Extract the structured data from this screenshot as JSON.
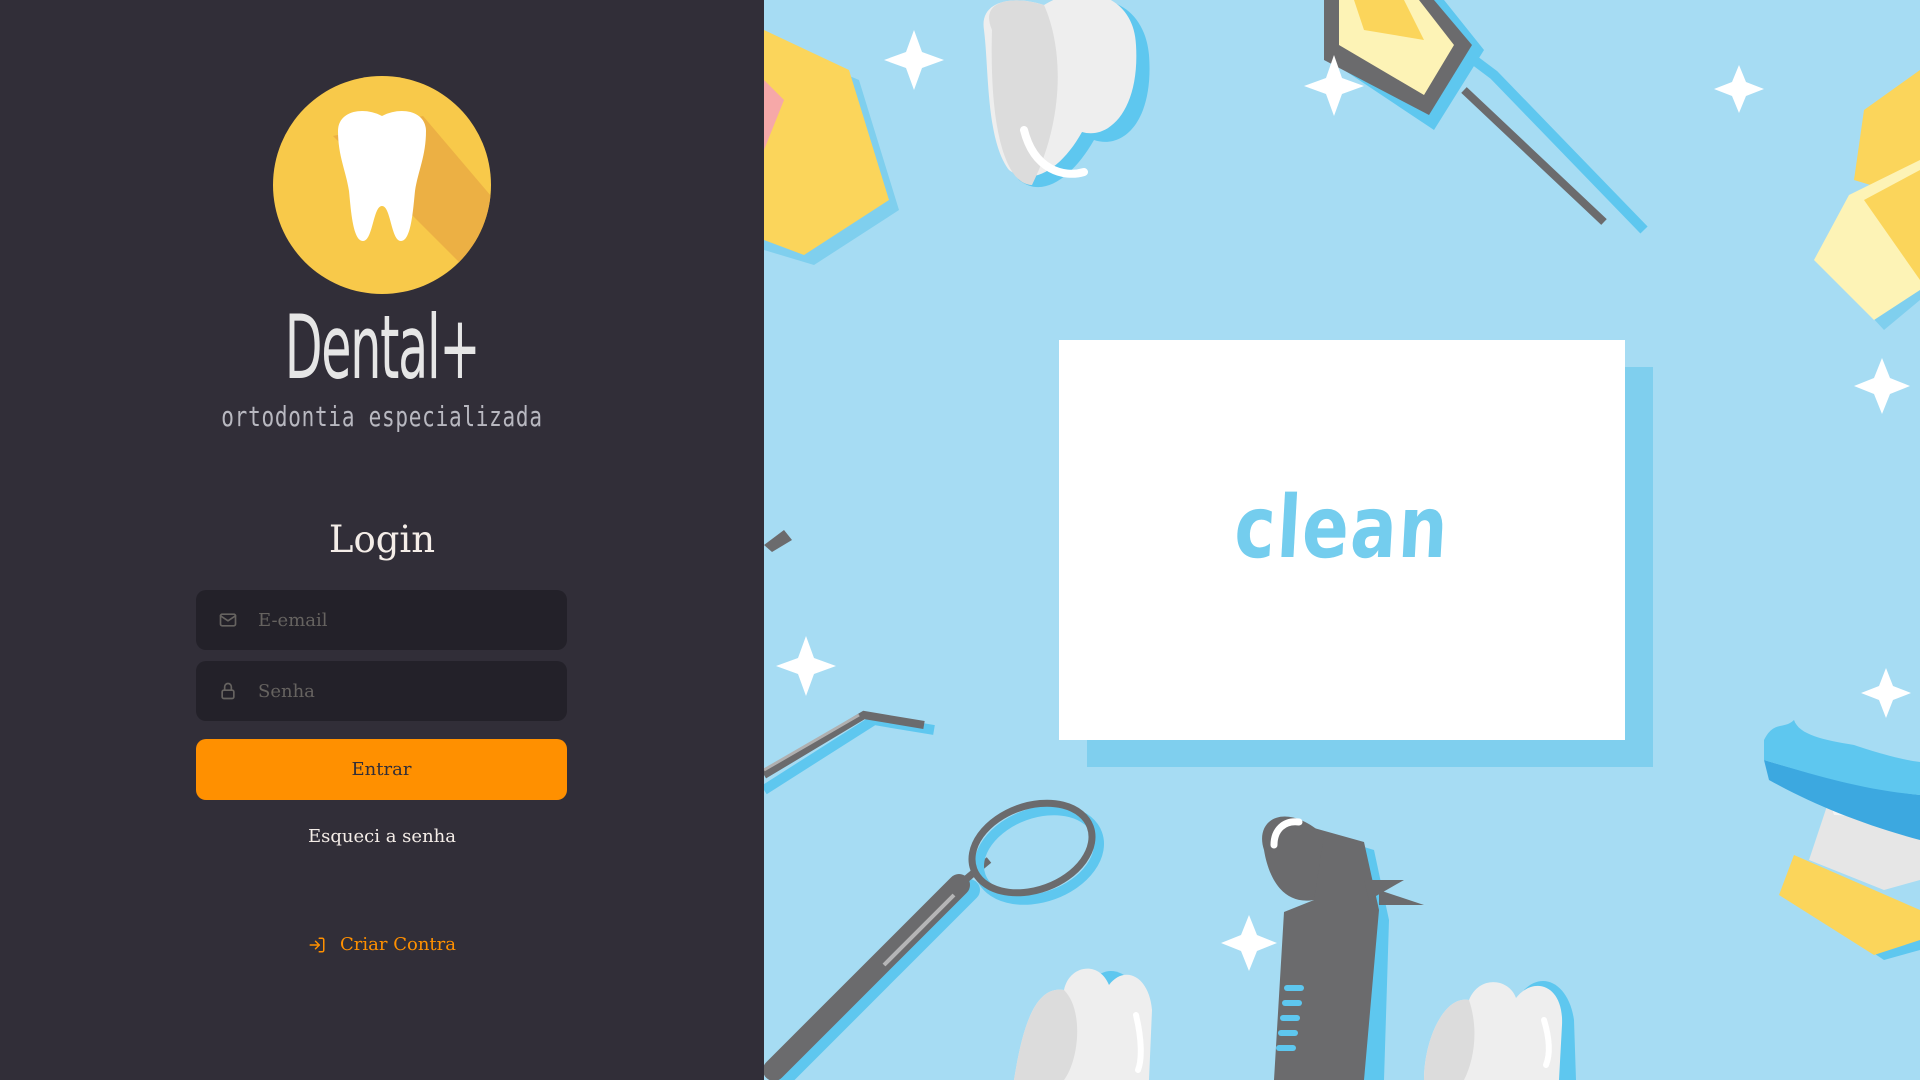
{
  "brand": {
    "name": "Dental+",
    "tagline": "ortodontia especializada"
  },
  "login": {
    "title": "Login",
    "email_placeholder": "E-email",
    "password_placeholder": "Senha",
    "submit_label": "Entrar",
    "forgot_label": "Esqueci a senha",
    "create_account_label": "Criar Contra"
  },
  "illustration": {
    "card_word": "clean"
  },
  "colors": {
    "sidebar_bg": "#312e38",
    "input_bg": "#232129",
    "accent": "#ff9000",
    "illustration_bg": "#a6dcf3",
    "logo_yellow": "#f8c94a"
  },
  "icons": {
    "logo": "tooth-icon",
    "email": "mail-icon",
    "password": "lock-icon",
    "create": "sign-in-icon"
  }
}
